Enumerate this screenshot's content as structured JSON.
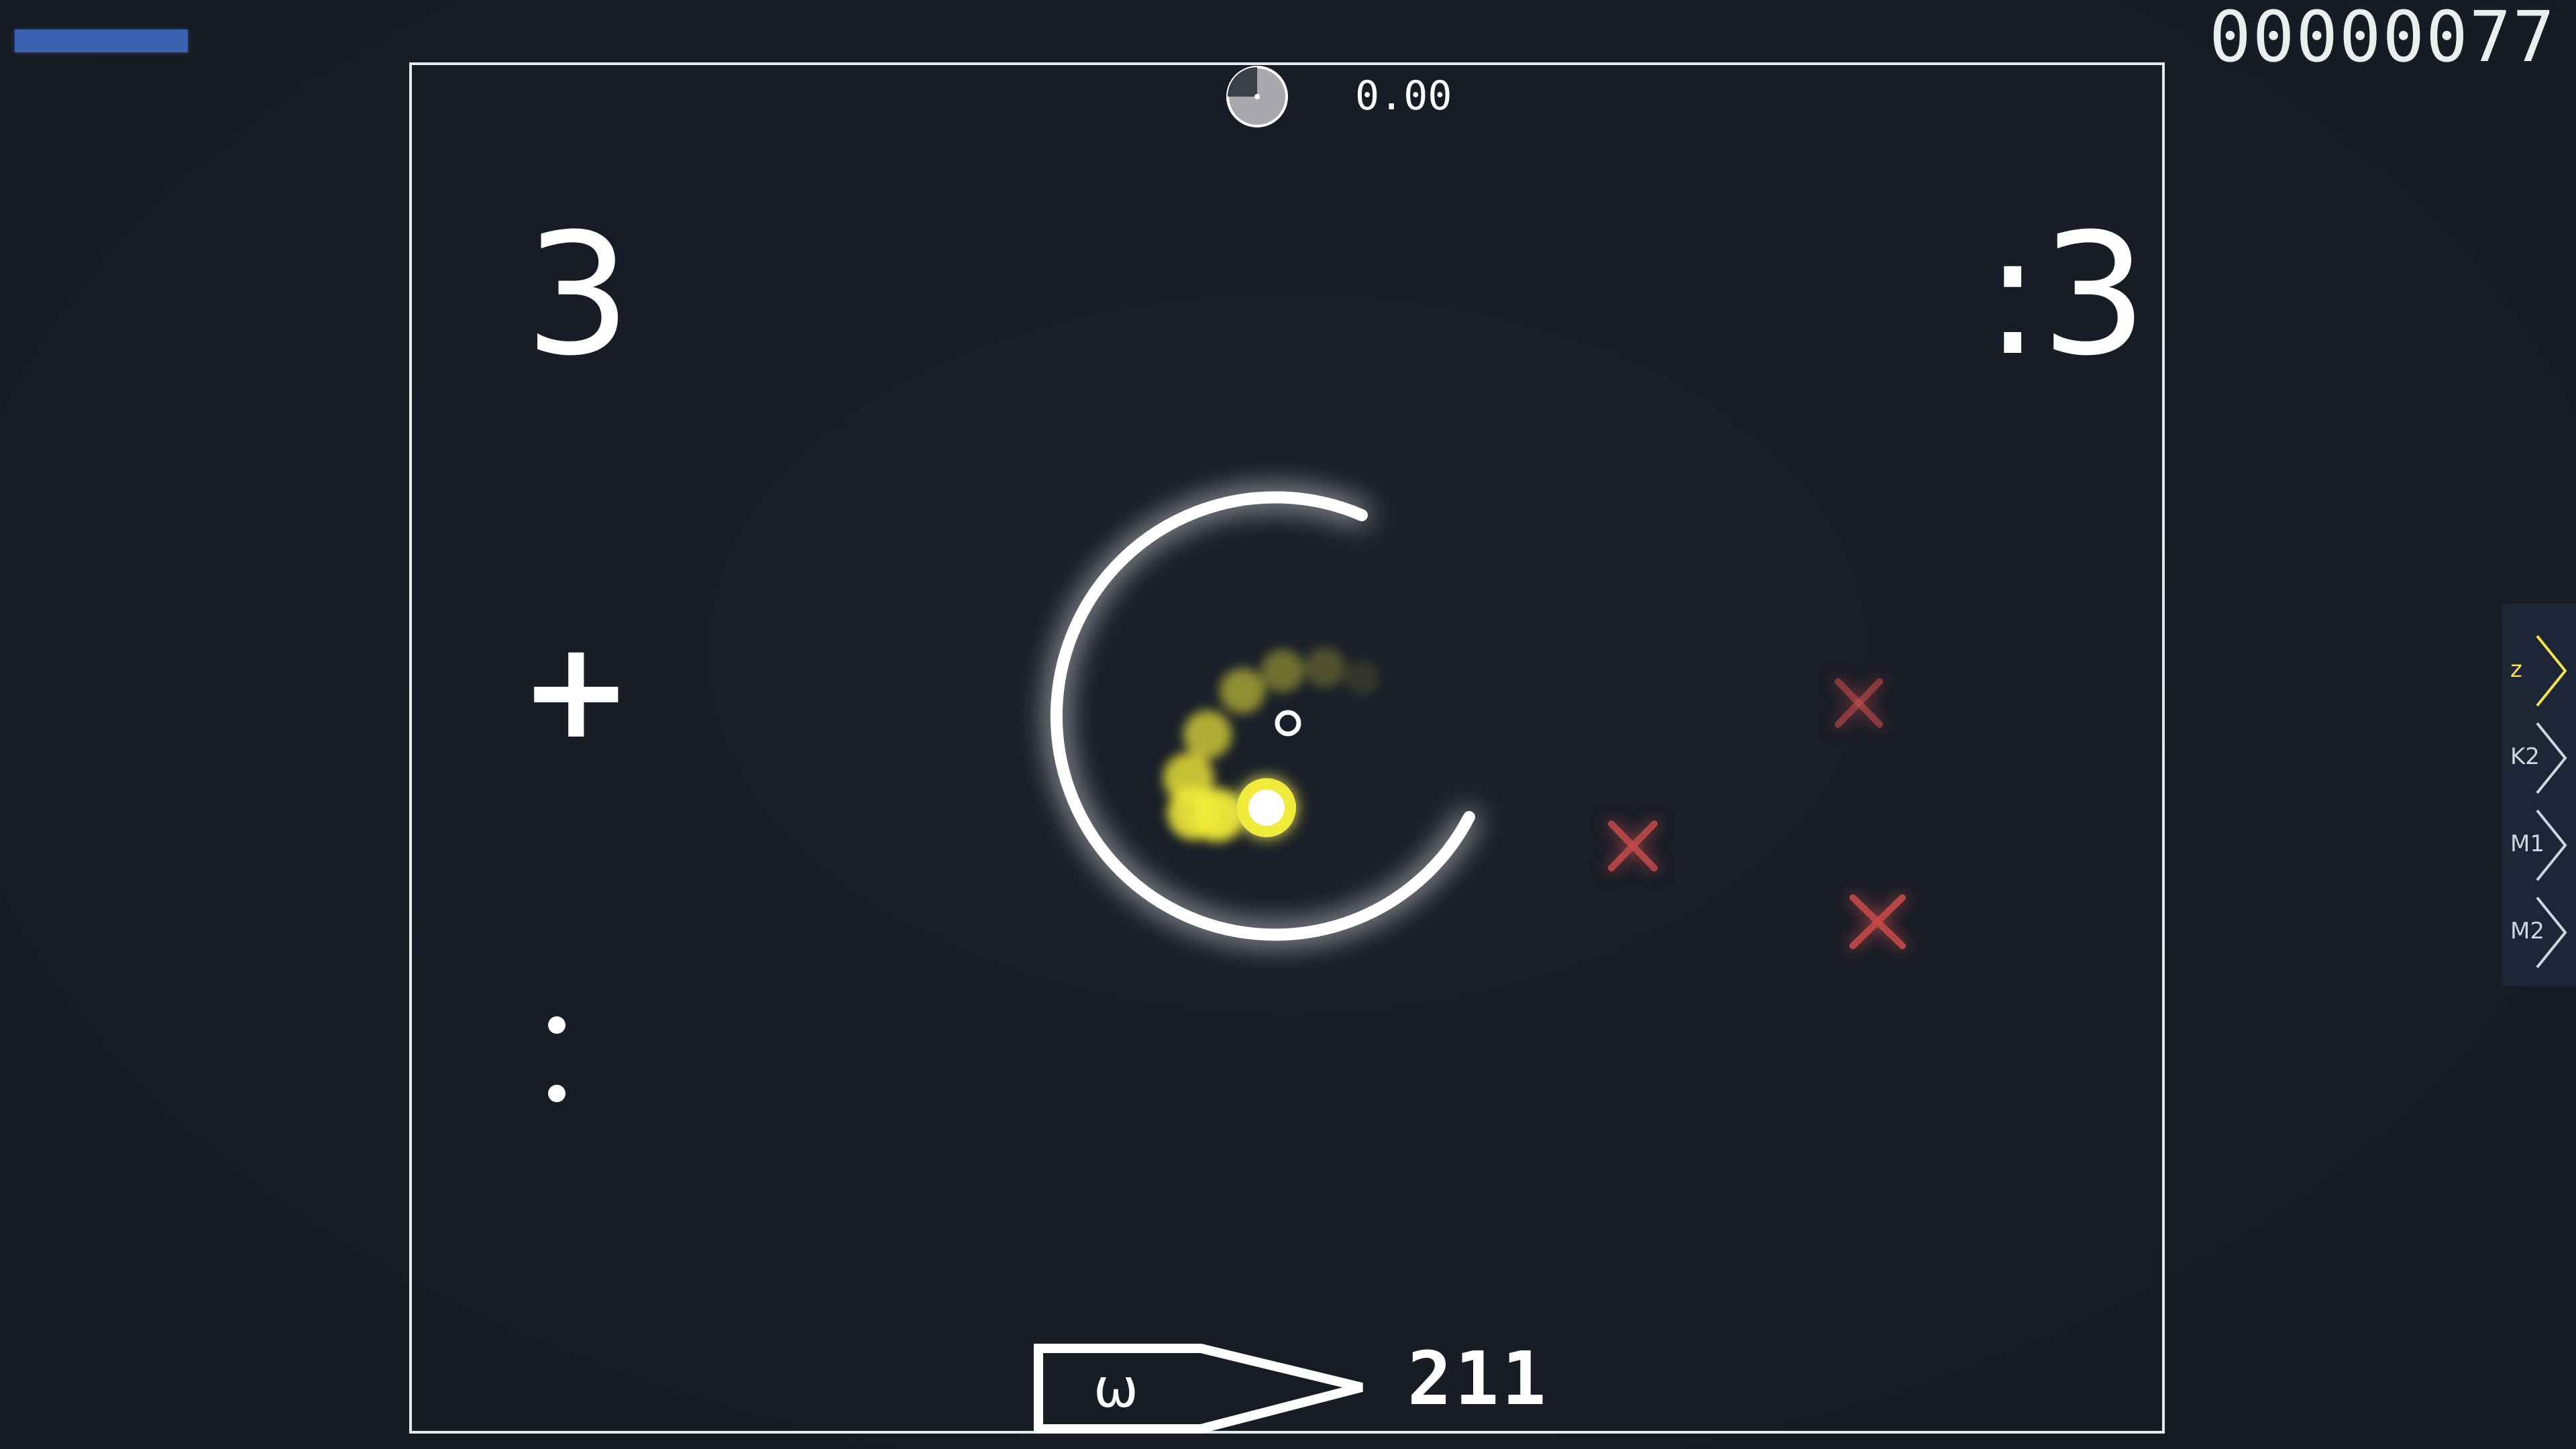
{
  "hud": {
    "health_fraction": 0.41,
    "health_color": "#3a64b2",
    "score": "00000077",
    "timer_text": "0.00",
    "timer_progress": 0.75
  },
  "playfield": {
    "combo_left": "3",
    "combo_right": ":3",
    "plus_mark": "+",
    "bottom_face": "ω",
    "bottom_count": "211"
  },
  "key_overlay": {
    "keys": [
      {
        "label": "z",
        "active": true
      },
      {
        "label": "K2",
        "active": false
      },
      {
        "label": "M1",
        "active": false
      },
      {
        "label": "M2",
        "active": false
      }
    ],
    "active_color": "#f5e24a",
    "inactive_color": "#cfd6e2"
  },
  "objects": {
    "cursor_color": "#ffffff",
    "cursor_trail_color": "#f0ea3a",
    "miss_color": "#c24a4a",
    "miss_marks": [
      "x",
      "x",
      "x"
    ]
  }
}
